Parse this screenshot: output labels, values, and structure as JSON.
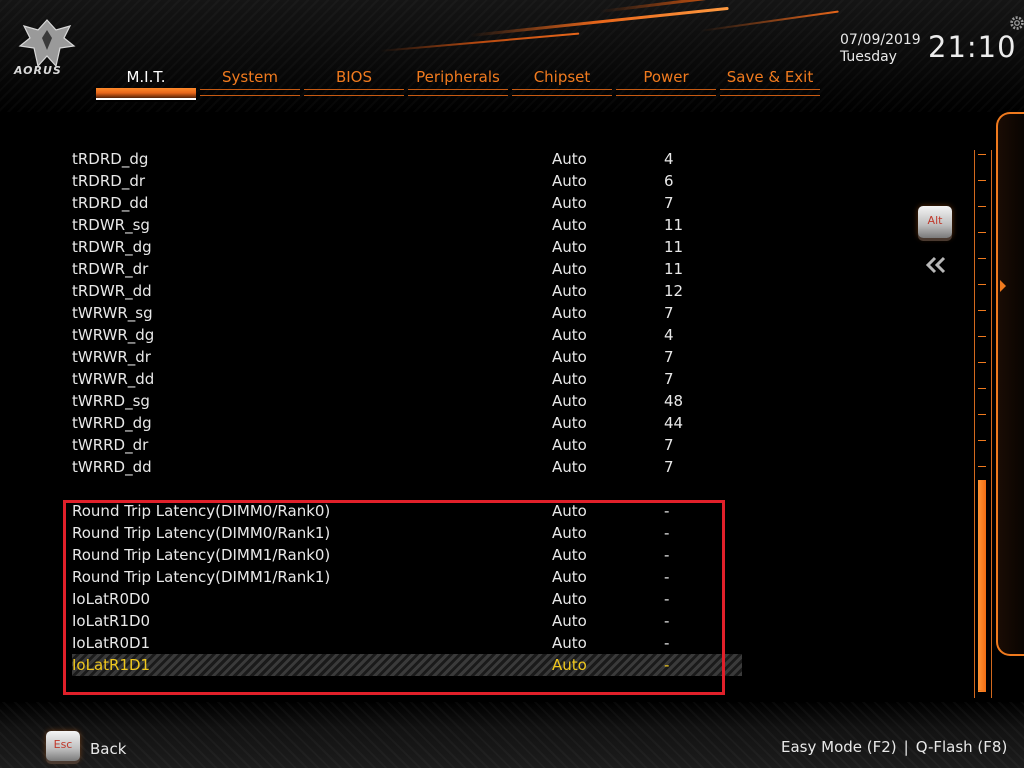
{
  "brand": {
    "logo_text": "AORUS"
  },
  "header": {
    "tabs": [
      {
        "label": "M.I.T.",
        "active": true
      },
      {
        "label": "System",
        "active": false
      },
      {
        "label": "BIOS",
        "active": false
      },
      {
        "label": "Peripherals",
        "active": false
      },
      {
        "label": "Chipset",
        "active": false
      },
      {
        "label": "Power",
        "active": false
      },
      {
        "label": "Save & Exit",
        "active": false
      }
    ],
    "date": "07/09/2019",
    "day": "Tuesday",
    "time": "21:10",
    "settings_icon": "gear-icon"
  },
  "settings": [
    {
      "name": "tRDRD_dg",
      "setting": "Auto",
      "value": "4"
    },
    {
      "name": "tRDRD_dr",
      "setting": "Auto",
      "value": "6"
    },
    {
      "name": "tRDRD_dd",
      "setting": "Auto",
      "value": "7"
    },
    {
      "name": "tRDWR_sg",
      "setting": "Auto",
      "value": "11"
    },
    {
      "name": "tRDWR_dg",
      "setting": "Auto",
      "value": "11"
    },
    {
      "name": "tRDWR_dr",
      "setting": "Auto",
      "value": "11"
    },
    {
      "name": "tRDWR_dd",
      "setting": "Auto",
      "value": "12"
    },
    {
      "name": "tWRWR_sg",
      "setting": "Auto",
      "value": "7"
    },
    {
      "name": "tWRWR_dg",
      "setting": "Auto",
      "value": "4"
    },
    {
      "name": "tWRWR_dr",
      "setting": "Auto",
      "value": "7"
    },
    {
      "name": "tWRWR_dd",
      "setting": "Auto",
      "value": "7"
    },
    {
      "name": "tWRRD_sg",
      "setting": "Auto",
      "value": "48"
    },
    {
      "name": "tWRRD_dg",
      "setting": "Auto",
      "value": "44"
    },
    {
      "name": "tWRRD_dr",
      "setting": "Auto",
      "value": "7"
    },
    {
      "name": "tWRRD_dd",
      "setting": "Auto",
      "value": "7"
    }
  ],
  "latency_settings": [
    {
      "name": "Round Trip Latency(DIMM0/Rank0)",
      "setting": "Auto",
      "value": "-"
    },
    {
      "name": "Round Trip Latency(DIMM0/Rank1)",
      "setting": "Auto",
      "value": "-"
    },
    {
      "name": "Round Trip Latency(DIMM1/Rank0)",
      "setting": "Auto",
      "value": "-"
    },
    {
      "name": "Round Trip Latency(DIMM1/Rank1)",
      "setting": "Auto",
      "value": "-"
    },
    {
      "name": "IoLatR0D0",
      "setting": "Auto",
      "value": "-"
    },
    {
      "name": "IoLatR1D0",
      "setting": "Auto",
      "value": "-"
    },
    {
      "name": "IoLatR0D1",
      "setting": "Auto",
      "value": "-"
    },
    {
      "name": "IoLatR1D1",
      "setting": "Auto",
      "value": "-",
      "selected": true
    }
  ],
  "side": {
    "alt_key_label": "Alt",
    "collapse_icon": "double-chevron-left-icon",
    "scroll_position": 0.62
  },
  "footer": {
    "esc_key_label": "Esc",
    "back_label": "Back",
    "easy_mode_label": "Easy Mode (F2)",
    "separator": "|",
    "qflash_label": "Q-Flash (F8)"
  },
  "colors": {
    "accent": "#f07a1e",
    "selected_text": "#f0c81e",
    "highlight_box": "#e0202a",
    "text": "#e8e8e8"
  }
}
